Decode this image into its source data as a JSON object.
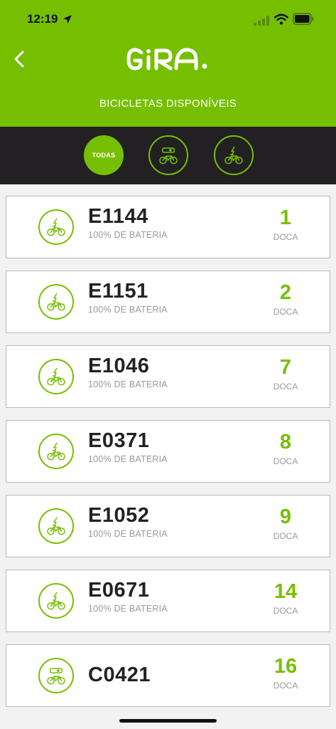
{
  "status_bar": {
    "time": "12:19"
  },
  "header": {
    "subtitle": "BICICLETAS DISPONÍVEIS",
    "logo_text": "GiRA."
  },
  "filters": [
    {
      "label": "TODAS",
      "icon": "all",
      "selected": true
    },
    {
      "label": "",
      "icon": "classic-bike-icon",
      "selected": false
    },
    {
      "label": "",
      "icon": "electric-bike-icon",
      "selected": false
    }
  ],
  "bikes": [
    {
      "id": "E1144",
      "battery": "100% DE BATERIA",
      "dock": "1",
      "dock_label": "DOCA",
      "type": "electric"
    },
    {
      "id": "E1151",
      "battery": "100% DE BATERIA",
      "dock": "2",
      "dock_label": "DOCA",
      "type": "electric"
    },
    {
      "id": "E1046",
      "battery": "100% DE BATERIA",
      "dock": "7",
      "dock_label": "DOCA",
      "type": "electric"
    },
    {
      "id": "E0371",
      "battery": "100% DE BATERIA",
      "dock": "8",
      "dock_label": "DOCA",
      "type": "electric"
    },
    {
      "id": "E1052",
      "battery": "100% DE BATERIA",
      "dock": "9",
      "dock_label": "DOCA",
      "type": "electric"
    },
    {
      "id": "E0671",
      "battery": "100% DE BATERIA",
      "dock": "14",
      "dock_label": "DOCA",
      "type": "electric"
    },
    {
      "id": "C0421",
      "battery": "",
      "dock": "16",
      "dock_label": "DOCA",
      "type": "classic"
    }
  ],
  "colors": {
    "accent": "#76bf00",
    "dark_bar": "#222022",
    "background": "#f2f2f2"
  }
}
